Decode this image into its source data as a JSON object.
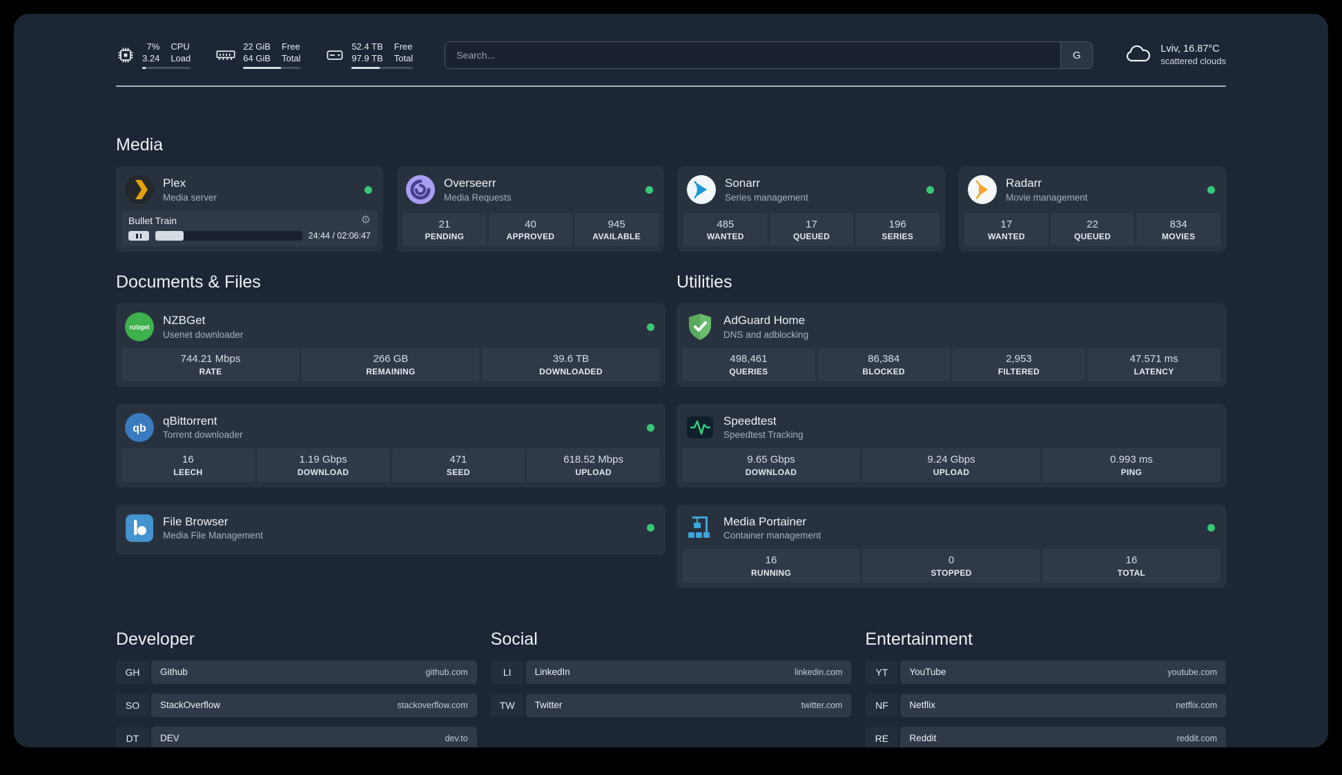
{
  "topbar": {
    "cpu": {
      "value_top": "7%",
      "value_bottom": "3.24",
      "label_top": "CPU",
      "label_bottom": "Load"
    },
    "memory": {
      "value_top": "22 GiB",
      "value_bottom": "64 GiB",
      "label_top": "Free",
      "label_bottom": "Total"
    },
    "disk": {
      "value_top": "52.4 TB",
      "value_bottom": "97.9 TB",
      "label_top": "Free",
      "label_bottom": "Total"
    },
    "search": {
      "placeholder": "Search...",
      "provider_label": "G"
    },
    "weather": {
      "location": "Lviv, 16.87°C",
      "condition": "scattered clouds"
    }
  },
  "sections": {
    "media_title": "Media",
    "documents_title": "Documents & Files",
    "utilities_title": "Utilities"
  },
  "services": {
    "plex": {
      "name": "Plex",
      "desc": "Media server",
      "now_playing": "Bullet Train",
      "time": "24:44 / 02:06:47"
    },
    "overseerr": {
      "name": "Overseerr",
      "desc": "Media Requests",
      "stats": [
        {
          "value": "21",
          "label": "PENDING"
        },
        {
          "value": "40",
          "label": "APPROVED"
        },
        {
          "value": "945",
          "label": "AVAILABLE"
        }
      ]
    },
    "sonarr": {
      "name": "Sonarr",
      "desc": "Series management",
      "stats": [
        {
          "value": "485",
          "label": "WANTED"
        },
        {
          "value": "17",
          "label": "QUEUED"
        },
        {
          "value": "196",
          "label": "SERIES"
        }
      ]
    },
    "radarr": {
      "name": "Radarr",
      "desc": "Movie management",
      "stats": [
        {
          "value": "17",
          "label": "WANTED"
        },
        {
          "value": "22",
          "label": "QUEUED"
        },
        {
          "value": "834",
          "label": "MOVIES"
        }
      ]
    },
    "nzbget": {
      "name": "NZBGet",
      "desc": "Usenet downloader",
      "stats": [
        {
          "value": "744.21 Mbps",
          "label": "RATE"
        },
        {
          "value": "266 GB",
          "label": "REMAINING"
        },
        {
          "value": "39.6 TB",
          "label": "DOWNLOADED"
        }
      ]
    },
    "qbittorrent": {
      "name": "qBittorrent",
      "desc": "Torrent downloader",
      "stats": [
        {
          "value": "16",
          "label": "LEECH"
        },
        {
          "value": "1.19 Gbps",
          "label": "DOWNLOAD"
        },
        {
          "value": "471",
          "label": "SEED"
        },
        {
          "value": "618.52 Mbps",
          "label": "UPLOAD"
        }
      ]
    },
    "filebrowser": {
      "name": "File Browser",
      "desc": "Media File Management"
    },
    "adguard": {
      "name": "AdGuard Home",
      "desc": "DNS and adblocking",
      "stats": [
        {
          "value": "498,461",
          "label": "QUERIES"
        },
        {
          "value": "86,384",
          "label": "BLOCKED"
        },
        {
          "value": "2,953",
          "label": "FILTERED"
        },
        {
          "value": "47.571 ms",
          "label": "LATENCY"
        }
      ]
    },
    "speedtest": {
      "name": "Speedtest",
      "desc": "Speedtest Tracking",
      "stats": [
        {
          "value": "9.65 Gbps",
          "label": "DOWNLOAD"
        },
        {
          "value": "9.24 Gbps",
          "label": "UPLOAD"
        },
        {
          "value": "0.993 ms",
          "label": "PING"
        }
      ]
    },
    "portainer": {
      "name": "Media Portainer",
      "desc": "Container management",
      "stats": [
        {
          "value": "16",
          "label": "RUNNING"
        },
        {
          "value": "0",
          "label": "STOPPED"
        },
        {
          "value": "16",
          "label": "TOTAL"
        }
      ]
    }
  },
  "bookmarks": {
    "sections": [
      {
        "title": "Developer",
        "items": [
          {
            "abbr": "GH",
            "name": "Github",
            "domain": "github.com"
          },
          {
            "abbr": "SO",
            "name": "StackOverflow",
            "domain": "stackoverflow.com"
          },
          {
            "abbr": "DT",
            "name": "DEV",
            "domain": "dev.to"
          }
        ]
      },
      {
        "title": "Social",
        "items": [
          {
            "abbr": "LI",
            "name": "LinkedIn",
            "domain": "linkedin.com"
          },
          {
            "abbr": "TW",
            "name": "Twitter",
            "domain": "twitter.com"
          }
        ]
      },
      {
        "title": "Entertainment",
        "items": [
          {
            "abbr": "YT",
            "name": "YouTube",
            "domain": "youtube.com"
          },
          {
            "abbr": "NF",
            "name": "Netflix",
            "domain": "netflix.com"
          },
          {
            "abbr": "RE",
            "name": "Reddit",
            "domain": "reddit.com"
          }
        ]
      }
    ]
  },
  "colors": {
    "status_online": "#37c978"
  }
}
